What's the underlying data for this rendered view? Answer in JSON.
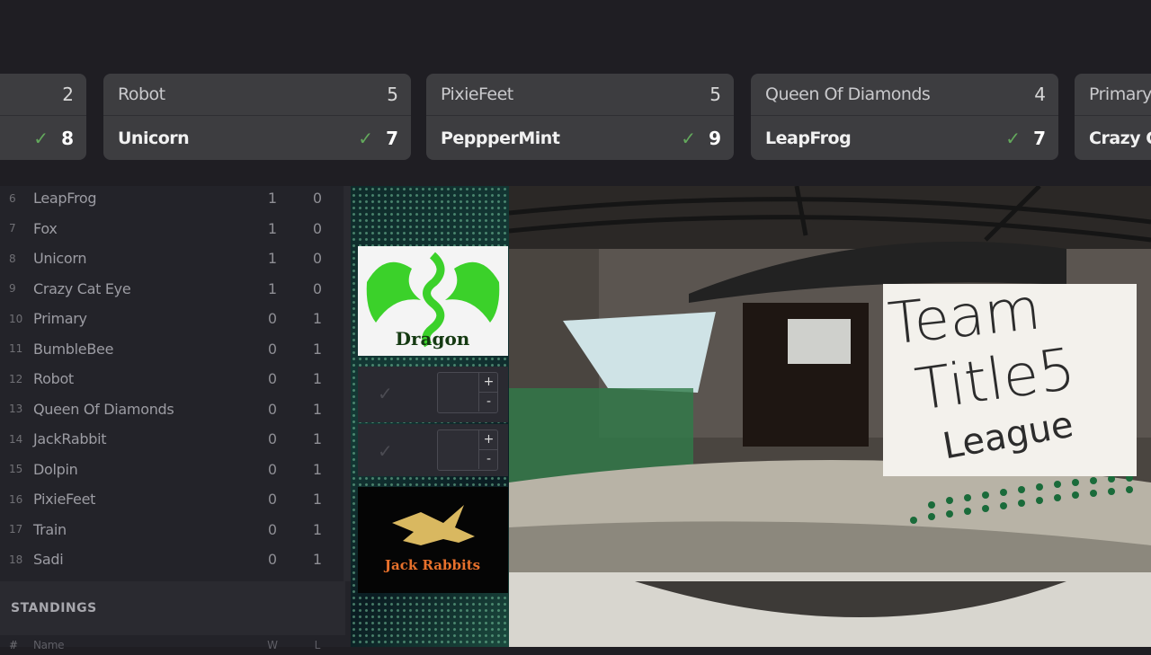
{
  "matchups": [
    {
      "top": {
        "name": "",
        "score": "2"
      },
      "bottom": {
        "name": "",
        "score": "8",
        "winner": true
      }
    },
    {
      "top": {
        "name": "Robot",
        "score": "5"
      },
      "bottom": {
        "name": "Unicorn",
        "score": "7",
        "winner": true
      }
    },
    {
      "top": {
        "name": "PixieFeet",
        "score": "5"
      },
      "bottom": {
        "name": "PeppperMint",
        "score": "9",
        "winner": true
      }
    },
    {
      "top": {
        "name": "Queen Of Diamonds",
        "score": "4"
      },
      "bottom": {
        "name": "LeapFrog",
        "score": "7",
        "winner": true
      }
    },
    {
      "top": {
        "name": "Primary",
        "score": ""
      },
      "bottom": {
        "name": "Crazy C",
        "score": ""
      }
    }
  ],
  "check_glyph": "✓",
  "standings_rows": [
    {
      "rank": "6",
      "name": "LeapFrog",
      "w": "1",
      "l": "0"
    },
    {
      "rank": "7",
      "name": "Fox",
      "w": "1",
      "l": "0"
    },
    {
      "rank": "8",
      "name": "Unicorn",
      "w": "1",
      "l": "0"
    },
    {
      "rank": "9",
      "name": "Crazy Cat Eye",
      "w": "1",
      "l": "0"
    },
    {
      "rank": "10",
      "name": "Primary",
      "w": "0",
      "l": "1"
    },
    {
      "rank": "11",
      "name": "BumbleBee",
      "w": "0",
      "l": "1"
    },
    {
      "rank": "12",
      "name": "Robot",
      "w": "0",
      "l": "1"
    },
    {
      "rank": "13",
      "name": "Queen Of Diamonds",
      "w": "0",
      "l": "1"
    },
    {
      "rank": "14",
      "name": "JackRabbit",
      "w": "0",
      "l": "1"
    },
    {
      "rank": "15",
      "name": "Dolpin",
      "w": "0",
      "l": "1"
    },
    {
      "rank": "16",
      "name": "PixieFeet",
      "w": "0",
      "l": "1"
    },
    {
      "rank": "17",
      "name": "Train",
      "w": "0",
      "l": "1"
    },
    {
      "rank": "18",
      "name": "Sadi",
      "w": "0",
      "l": "1"
    }
  ],
  "standings_section": {
    "title": "STANDINGS",
    "columns": {
      "rank": "#",
      "name": "Name",
      "w": "W",
      "l": "L"
    }
  },
  "pick_panel": {
    "top_team": "Dragon",
    "bottom_team": "Jack Rabbits",
    "stepper_plus": "+",
    "stepper_minus": "-"
  },
  "video": {
    "sign_line1": "Team",
    "sign_line2": "Title5",
    "sign_line3": "League"
  },
  "colors": {
    "win_check": "#63a95c",
    "dragon_green": "#3bd12a",
    "jack_orange": "#e8712c",
    "jack_gold": "#d9b860"
  }
}
